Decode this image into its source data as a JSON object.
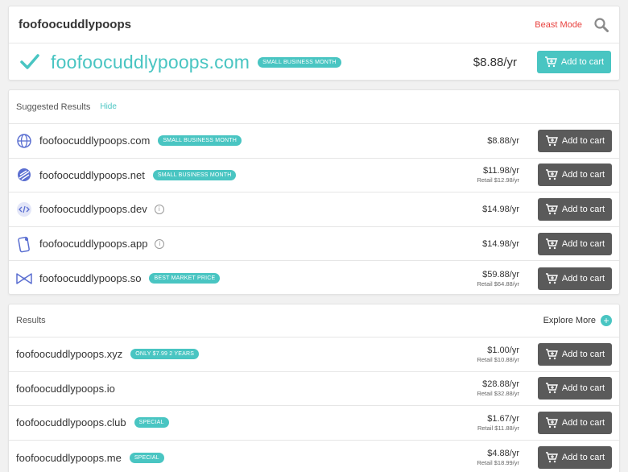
{
  "search": {
    "query": "foofoocuddlypoops",
    "beast_mode_label": "Beast Mode"
  },
  "hero": {
    "domain": "foofoocuddlypoops.com",
    "badge": "Small Business Month",
    "price": "$8.88/yr",
    "cart_label": "Add to cart"
  },
  "suggested": {
    "title": "Suggested Results",
    "hide_label": "Hide",
    "rows": [
      {
        "domain": "foofoocuddlypoops.com",
        "badge": "Small Business Month",
        "price": "$8.88/yr",
        "retail": "",
        "icon": "globe-icon",
        "cart_label": "Add to cart"
      },
      {
        "domain": "foofoocuddlypoops.net",
        "badge": "Small Business Month",
        "price": "$11.98/yr",
        "retail": "Retail $12.98/yr",
        "icon": "net-icon",
        "cart_label": "Add to cart"
      },
      {
        "domain": "foofoocuddlypoops.dev",
        "badge": "",
        "price": "$14.98/yr",
        "retail": "",
        "icon": "code-icon",
        "cart_label": "Add to cart"
      },
      {
        "domain": "foofoocuddlypoops.app",
        "badge": "",
        "price": "$14.98/yr",
        "retail": "",
        "icon": "app-icon",
        "cart_label": "Add to cart"
      },
      {
        "domain": "foofoocuddlypoops.so",
        "badge": "Best Market Price",
        "price": "$59.88/yr",
        "retail": "Retail $64.88/yr",
        "icon": "bowtie-icon",
        "cart_label": "Add to cart"
      }
    ]
  },
  "results": {
    "title": "Results",
    "explore_label": "Explore More",
    "rows": [
      {
        "domain": "foofoocuddlypoops.xyz",
        "badge": "Only $7.99 2 Years",
        "price": "$1.00/yr",
        "retail": "Retail $10.88/yr",
        "cart_label": "Add to cart"
      },
      {
        "domain": "foofoocuddlypoops.io",
        "badge": "",
        "price": "$28.88/yr",
        "retail": "Retail $32.88/yr",
        "cart_label": "Add to cart"
      },
      {
        "domain": "foofoocuddlypoops.club",
        "badge": "Special",
        "price": "$1.67/yr",
        "retail": "Retail $11.88/yr",
        "cart_label": "Add to cart"
      },
      {
        "domain": "foofoocuddlypoops.me",
        "badge": "Special",
        "price": "$4.88/yr",
        "retail": "Retail $18.99/yr",
        "cart_label": "Add to cart"
      }
    ]
  },
  "colors": {
    "accent": "#49c5c2",
    "beast_mode": "#e8423f",
    "cart_button": "#5a5a5a"
  }
}
